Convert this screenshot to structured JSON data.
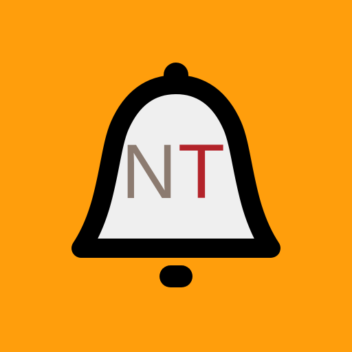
{
  "app_icon": {
    "name": "notification-bell",
    "background_color": "#FF9E0C",
    "bell_outline_color": "#000000",
    "bell_fill_color": "#EFEFEF",
    "logo": {
      "letter_n": "N",
      "letter_t": "T",
      "letter_n_color": "#8C7B70",
      "letter_t_color": "#B3232A"
    }
  }
}
